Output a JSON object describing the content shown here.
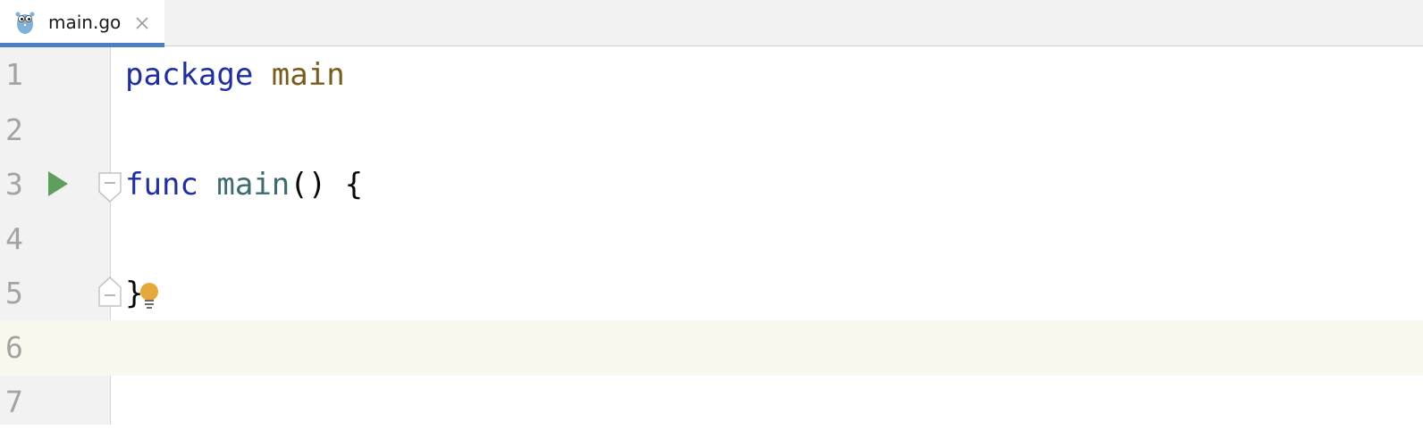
{
  "tabs": [
    {
      "title": "main.go",
      "icon": "gopher-icon",
      "active": true
    }
  ],
  "editor": {
    "current_line": 6,
    "lines": [
      {
        "number": "1",
        "tokens": [
          {
            "text": "package",
            "kind": "keyword"
          },
          {
            "text": " ",
            "kind": "space"
          },
          {
            "text": "main",
            "kind": "package"
          }
        ]
      },
      {
        "number": "2",
        "tokens": []
      },
      {
        "number": "3",
        "tokens": [
          {
            "text": "func",
            "kind": "keyword"
          },
          {
            "text": " ",
            "kind": "space"
          },
          {
            "text": "main",
            "kind": "function"
          },
          {
            "text": "() {",
            "kind": "punct"
          }
        ]
      },
      {
        "number": "4",
        "tokens": []
      },
      {
        "number": "5",
        "tokens": [
          {
            "text": "}",
            "kind": "punct"
          }
        ]
      },
      {
        "number": "6",
        "tokens": []
      },
      {
        "number": "7",
        "tokens": []
      }
    ]
  },
  "colors": {
    "keyword": "#1f2ea8",
    "package": "#7a5c1a",
    "function": "#3a6c72",
    "run": "#5e9e5e",
    "bulb": "#e4a93a",
    "tab_underline": "#4a7fc4",
    "current_line_bg": "#f9f8ec"
  },
  "icons": {
    "run": "run-icon",
    "fold_open": "fold-expanded-icon",
    "fold_close": "fold-end-icon",
    "intention": "lightbulb-icon",
    "close": "close-icon"
  }
}
